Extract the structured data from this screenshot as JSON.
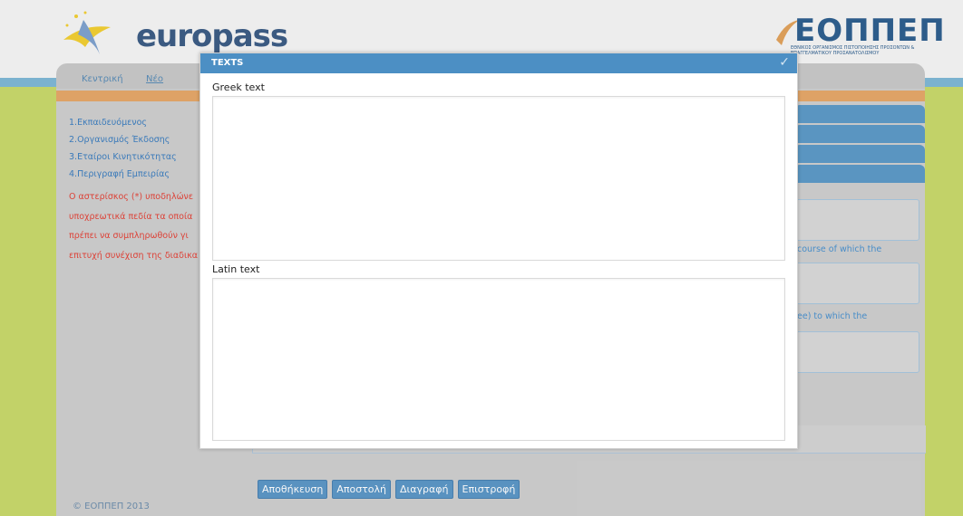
{
  "header": {
    "brand": "europass",
    "org_logo": "ΕΟΠΠΕΠ",
    "org_subtitle": "ΕΘΝΙΚΟΣ ΟΡΓΑΝΙΣΜΟΣ ΠΙΣΤΟΠΟΙΗΣΗΣ ΠΡΟΣΟΝΤΩΝ & ΕΠΑΓΓΕΛΜΑΤΙΚΟΥ ΠΡΟΣΑΝΑΤΟΛΙΣΜΟΥ"
  },
  "nav": {
    "home": "Κεντρική",
    "new": "Νέο"
  },
  "sidebar": {
    "items": [
      "1.Εκπαιδευόμενος",
      "2.Οργανισμός Έκδοσης",
      "3.Εταίροι Κινητικότητας",
      "4.Περιγραφή Εμπειρίας"
    ],
    "note_lines": [
      "Ο αστερίσκος (*) υποδηλώνε",
      "υποχρεωτικά πεδία τα οποία",
      "πρέπει να συμπληρωθούν γι",
      "επιτυχή συνέχιση της διαδικα"
    ]
  },
  "right_panel": {
    "text1": "course of which the",
    "text2": "ee) to which the"
  },
  "modal": {
    "title": "TEXTS",
    "greek_label": "Greek text",
    "latin_label": "Latin text"
  },
  "buttons": {
    "save": "Αποθήκευση",
    "send": "Αποστολή",
    "delete": "Διαγραφή",
    "back": "Επιστροφή"
  },
  "footer": "© ΕΟΠΠΕΠ 2013"
}
